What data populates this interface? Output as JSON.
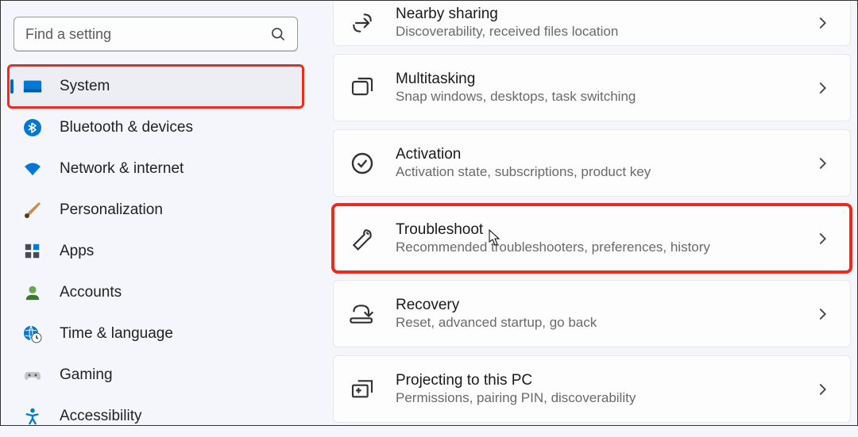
{
  "search": {
    "placeholder": "Find a setting"
  },
  "nav": [
    {
      "label": "System",
      "selected": true,
      "highlight": true
    },
    {
      "label": "Bluetooth & devices"
    },
    {
      "label": "Network & internet"
    },
    {
      "label": "Personalization"
    },
    {
      "label": "Apps"
    },
    {
      "label": "Accounts"
    },
    {
      "label": "Time & language"
    },
    {
      "label": "Gaming"
    },
    {
      "label": "Accessibility"
    }
  ],
  "rows": [
    {
      "title": "Nearby sharing",
      "subtitle": "Discoverability, received files location"
    },
    {
      "title": "Multitasking",
      "subtitle": "Snap windows, desktops, task switching"
    },
    {
      "title": "Activation",
      "subtitle": "Activation state, subscriptions, product key"
    },
    {
      "title": "Troubleshoot",
      "subtitle": "Recommended troubleshooters, preferences, history",
      "highlight": true
    },
    {
      "title": "Recovery",
      "subtitle": "Reset, advanced startup, go back"
    },
    {
      "title": "Projecting to this PC",
      "subtitle": "Permissions, pairing PIN, discoverability"
    }
  ]
}
